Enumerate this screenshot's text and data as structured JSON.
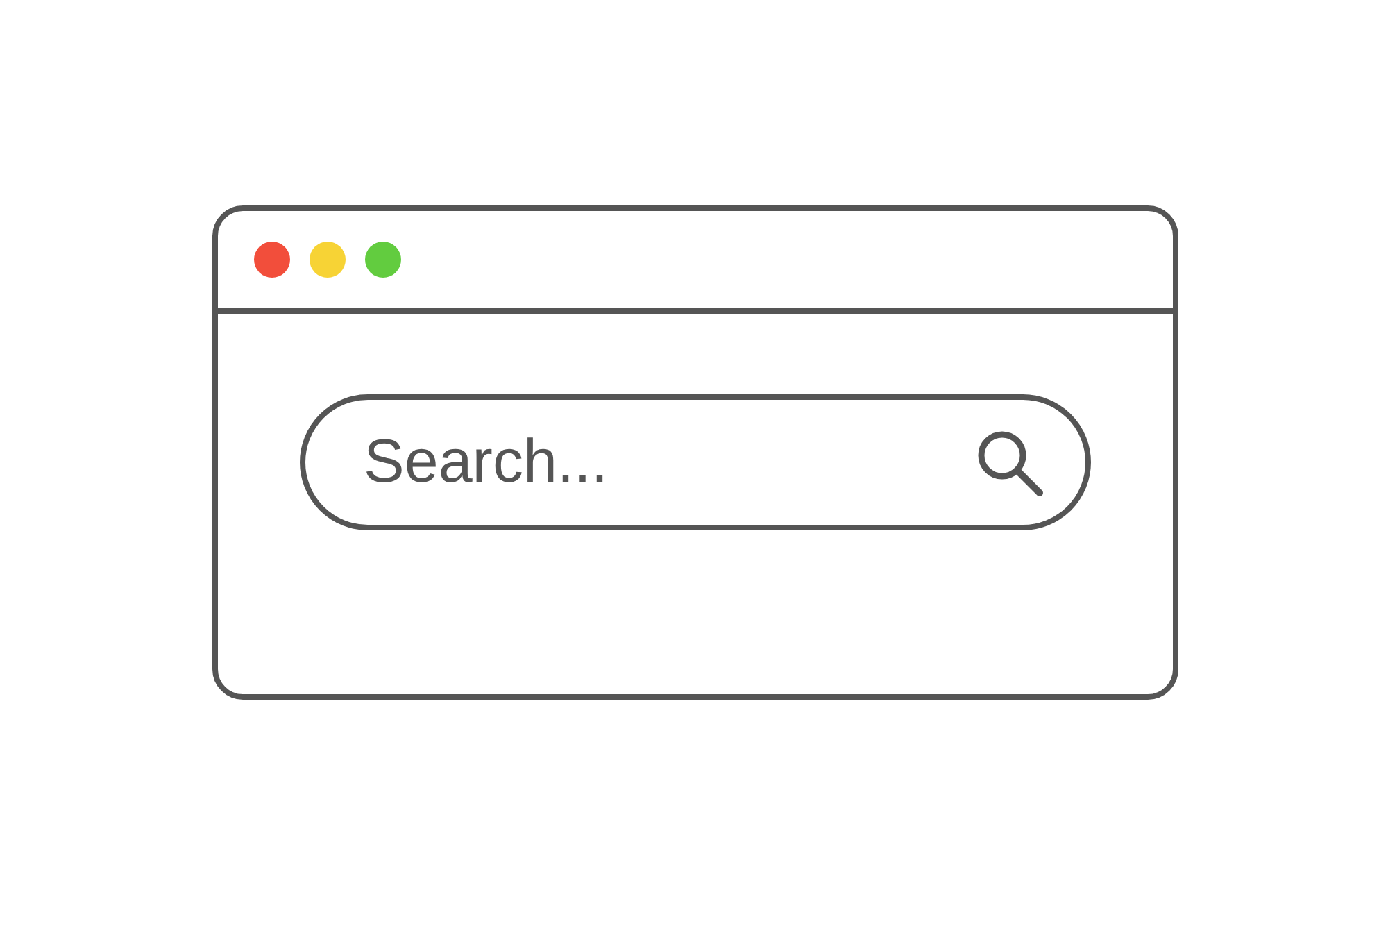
{
  "window": {
    "controls": [
      {
        "color": "#f24e3b"
      },
      {
        "color": "#f7d335"
      },
      {
        "color": "#62cc3f"
      }
    ]
  },
  "search": {
    "placeholder": "Search..."
  }
}
